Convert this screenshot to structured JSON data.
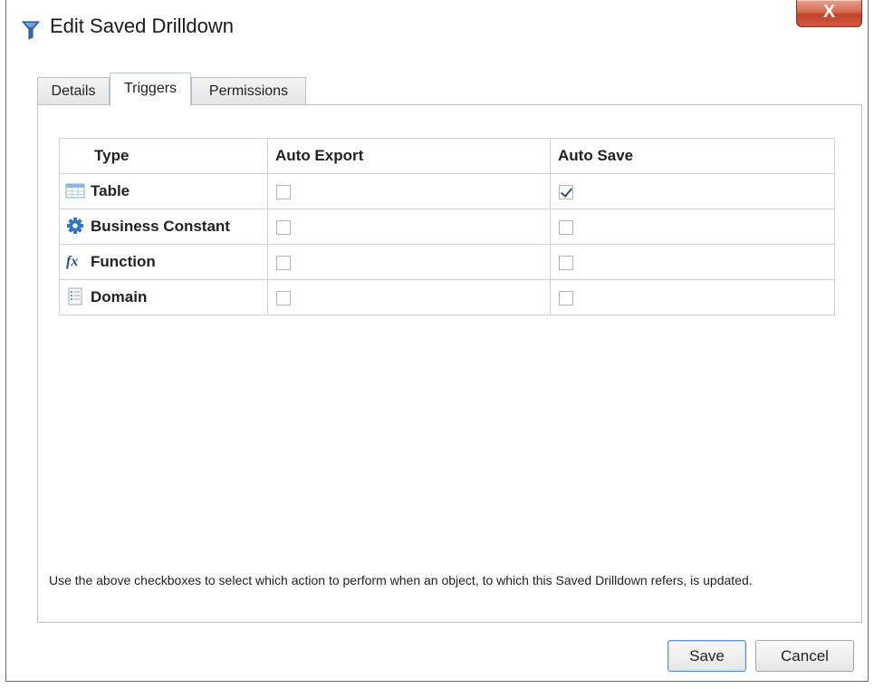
{
  "window": {
    "title": "Edit Saved Drilldown",
    "close_label": "X",
    "title_icon": "funnel-icon",
    "accent_color": "#2e6db4"
  },
  "tabs": [
    {
      "label": "Details",
      "active": false
    },
    {
      "label": "Triggers",
      "active": true
    },
    {
      "label": "Permissions",
      "active": false
    }
  ],
  "table": {
    "headers": [
      "Type",
      "Auto Export",
      "Auto Save"
    ],
    "rows": [
      {
        "type": "Table",
        "icon": "table-icon",
        "auto_export": false,
        "auto_save": true
      },
      {
        "type": "Business Constant",
        "icon": "gear-icon",
        "auto_export": false,
        "auto_save": false
      },
      {
        "type": "Function",
        "icon": "function-fx-icon",
        "auto_export": false,
        "auto_save": false
      },
      {
        "type": "Domain",
        "icon": "domain-list-icon",
        "auto_export": false,
        "auto_save": false
      }
    ]
  },
  "help_text": "Use the above checkboxes to select which action to perform when an object, to which this Saved Drilldown refers, is updated.",
  "buttons": {
    "save": "Save",
    "cancel": "Cancel"
  }
}
